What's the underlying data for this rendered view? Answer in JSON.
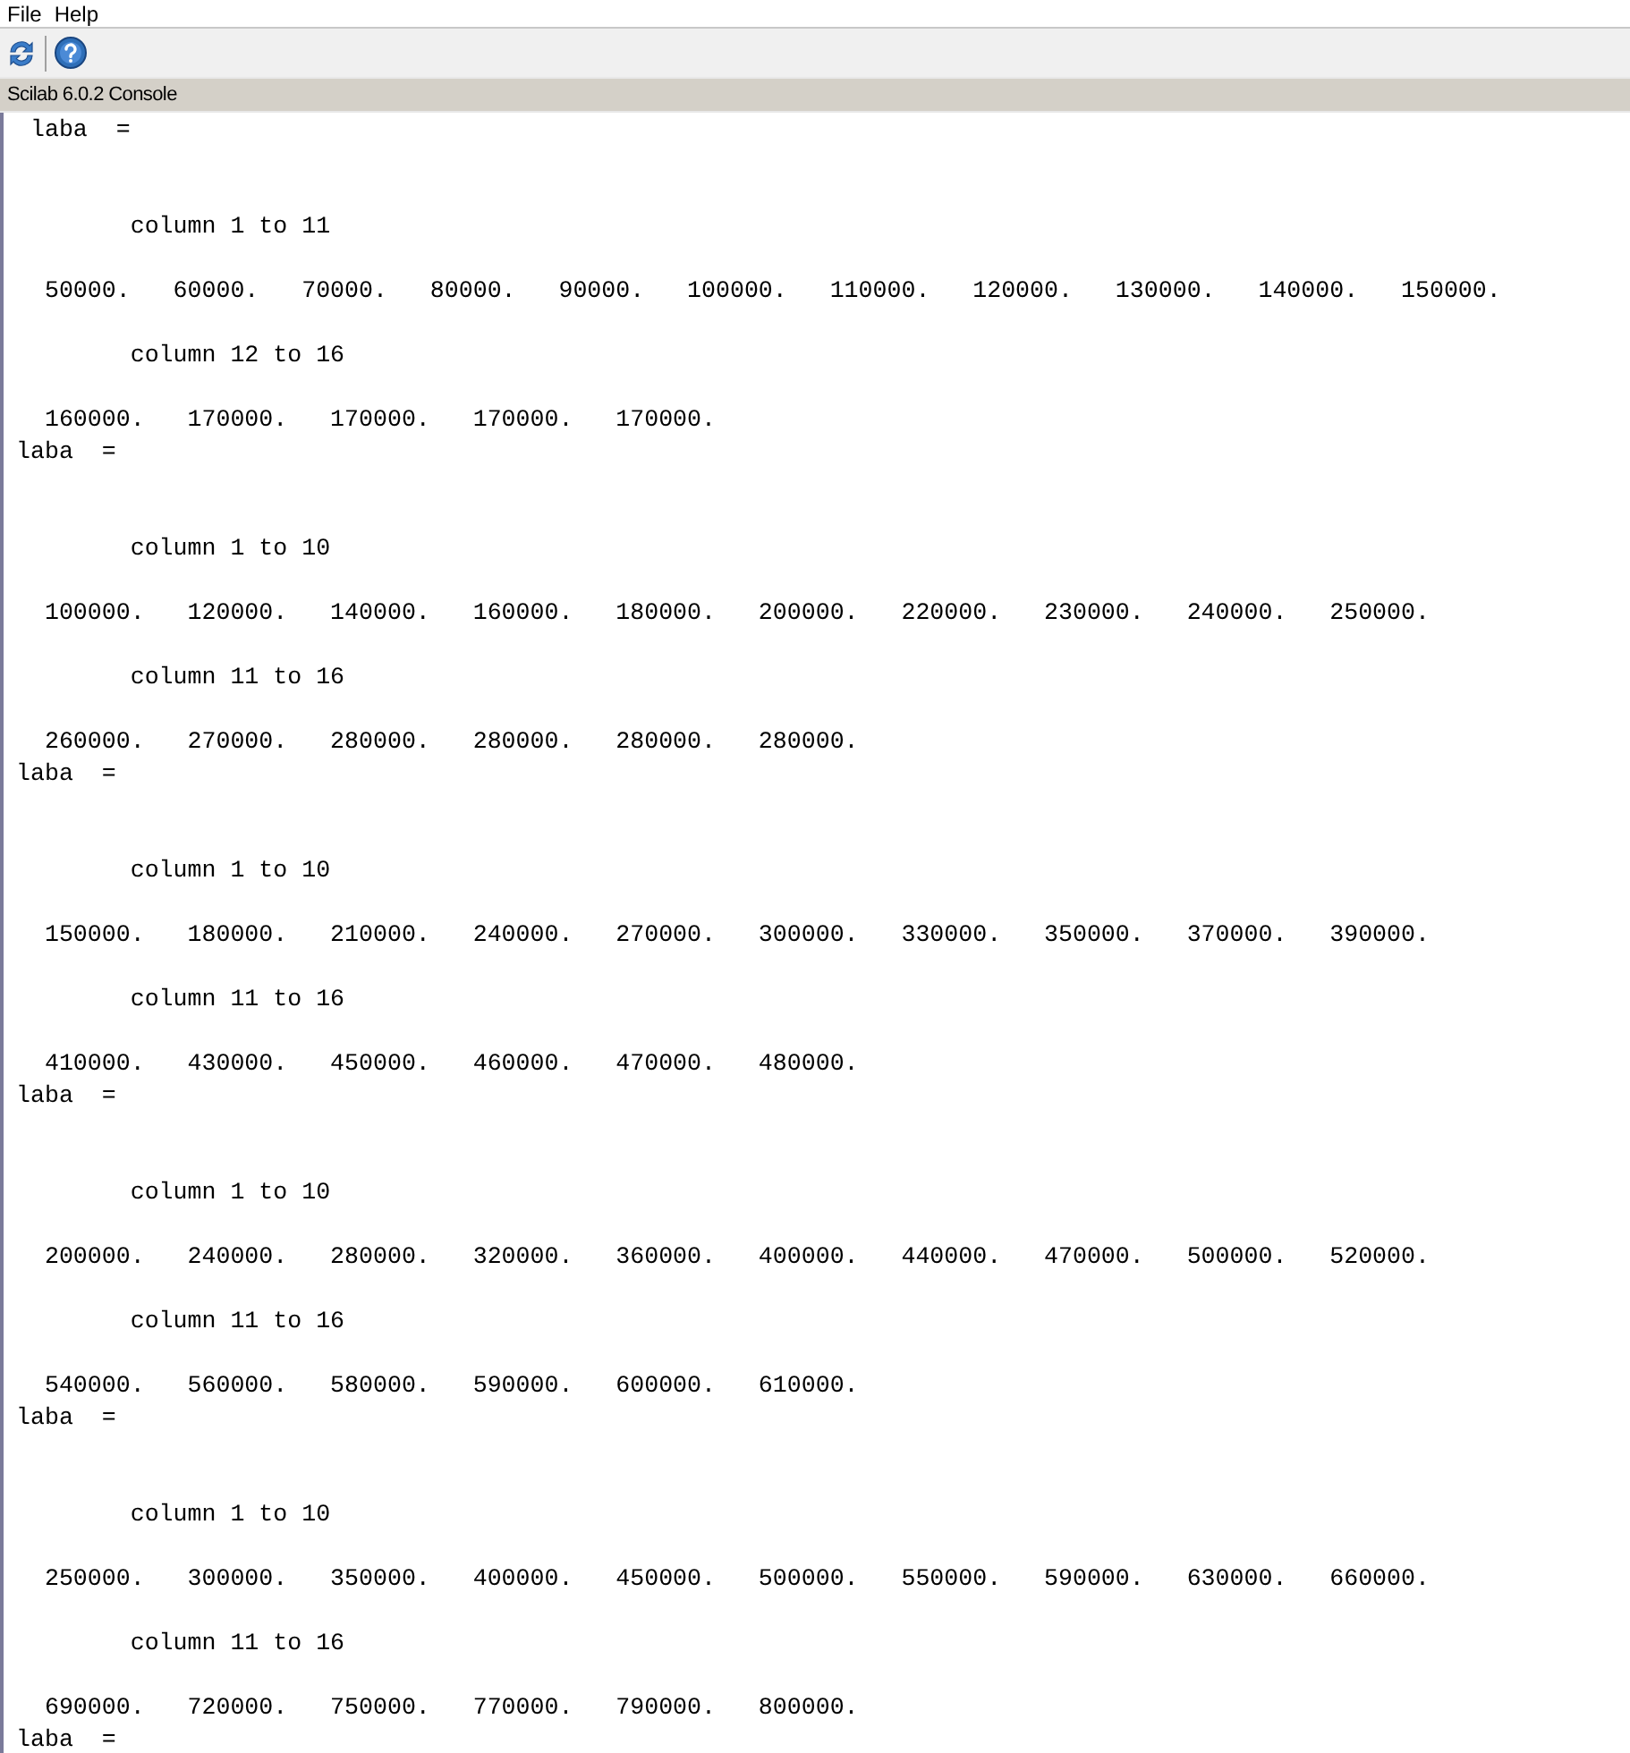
{
  "menu_bar": {
    "items": [
      "File",
      "Help"
    ]
  },
  "console": {
    "title": "Scilab 6.0.2 Console",
    "outputs": [
      {
        "variable": " laba  =",
        "blocks": [
          {
            "header": "        column 1 to 11",
            "values": "  50000.   60000.   70000.   80000.   90000.   100000.   110000.   120000.   130000.   140000.   150000."
          },
          {
            "header": "        column 12 to 16",
            "values": "  160000.   170000.   170000.   170000.   170000."
          }
        ]
      },
      {
        "variable": "laba  =",
        "blocks": [
          {
            "header": "        column 1 to 10",
            "values": "  100000.   120000.   140000.   160000.   180000.   200000.   220000.   230000.   240000.   250000."
          },
          {
            "header": "        column 11 to 16",
            "values": "  260000.   270000.   280000.   280000.   280000.   280000."
          }
        ]
      },
      {
        "variable": "laba  =",
        "blocks": [
          {
            "header": "        column 1 to 10",
            "values": "  150000.   180000.   210000.   240000.   270000.   300000.   330000.   350000.   370000.   390000."
          },
          {
            "header": "        column 11 to 16",
            "values": "  410000.   430000.   450000.   460000.   470000.   480000."
          }
        ]
      },
      {
        "variable": "laba  =",
        "blocks": [
          {
            "header": "        column 1 to 10",
            "values": "  200000.   240000.   280000.   320000.   360000.   400000.   440000.   470000.   500000.   520000."
          },
          {
            "header": "        column 11 to 16",
            "values": "  540000.   560000.   580000.   590000.   600000.   610000."
          }
        ]
      },
      {
        "variable": "laba  =",
        "blocks": [
          {
            "header": "        column 1 to 10",
            "values": "  250000.   300000.   350000.   400000.   450000.   500000.   550000.   590000.   630000.   660000."
          },
          {
            "header": "        column 11 to 16",
            "values": "  690000.   720000.   750000.   770000.   790000.   800000."
          }
        ]
      },
      {
        "variable": "laba  ="
      }
    ]
  }
}
